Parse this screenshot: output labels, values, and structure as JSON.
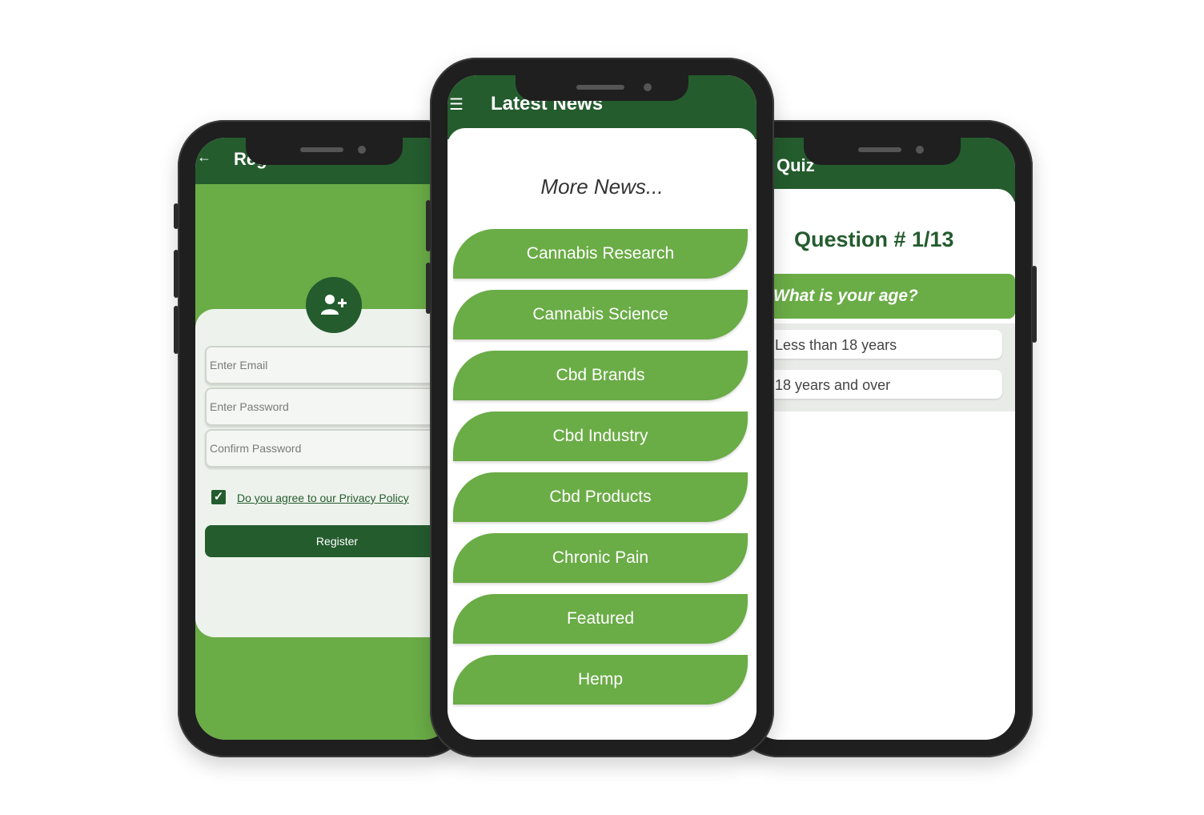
{
  "register": {
    "title": "Register User",
    "email_placeholder": "Enter Email",
    "password_placeholder": "Enter Password",
    "confirm_placeholder": "Confirm Password",
    "terms_label": "Do you agree to our Privacy Policy",
    "register_label": "Register"
  },
  "news": {
    "title": "Latest News",
    "more_label": "More News...",
    "categories": [
      "Cannabis Research",
      "Cannabis Science",
      "Cbd Brands",
      "Cbd Industry",
      "Cbd Products",
      "Chronic Pain",
      "Featured",
      "Hemp"
    ]
  },
  "quiz": {
    "title": "Quiz",
    "question_number": "Question # 1/13",
    "question_text": "What is your age?",
    "options": [
      "Less than 18 years",
      "18 years and over"
    ]
  },
  "colors": {
    "dark_green": "#245c2e",
    "light_green": "#6aac46",
    "frame": "#1f1f1f"
  }
}
